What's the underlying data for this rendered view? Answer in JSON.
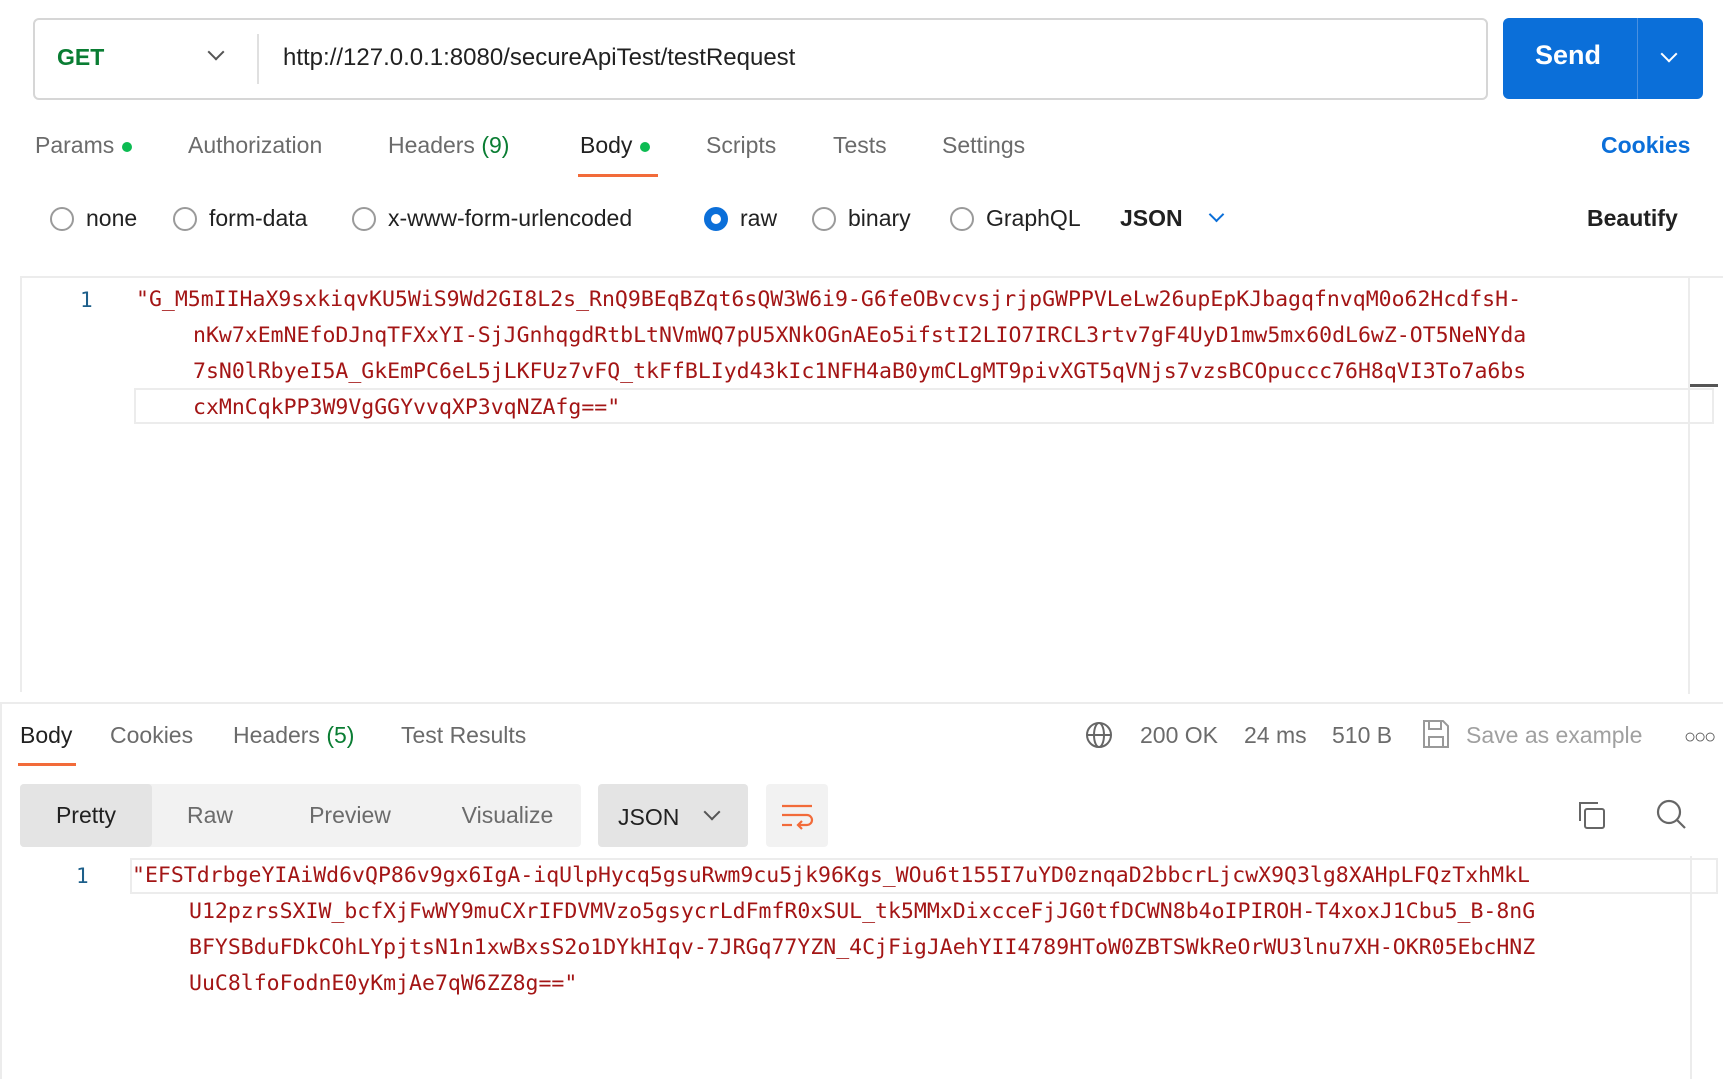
{
  "request": {
    "method": "GET",
    "url": "http://127.0.0.1:8080/secureApiTest/testRequest",
    "send_label": "Send"
  },
  "req_tabs": [
    {
      "label": "Params",
      "dot": true
    },
    {
      "label": "Authorization"
    },
    {
      "label": "Headers",
      "count": "(9)"
    },
    {
      "label": "Body",
      "dot": true,
      "active": true
    },
    {
      "label": "Scripts"
    },
    {
      "label": "Tests"
    },
    {
      "label": "Settings"
    }
  ],
  "cookies_link": "Cookies",
  "body_types": [
    "none",
    "form-data",
    "x-www-form-urlencoded",
    "raw",
    "binary",
    "GraphQL"
  ],
  "body_type_selected": "raw",
  "body_format": "JSON",
  "beautify_label": "Beautify",
  "request_body": {
    "line_number": "1",
    "lines": [
      "\"G_M5mIIHaX9sxkiqvKU5WiS9Wd2GI8L2s_RnQ9BEqBZqt6sQW3W6i9-G6feOBvcvsjrjpGWPPVLeLw26upEpKJbagqfnvqM0o62HcdfsH-",
      "nKw7xEmNEfoDJnqTFXxYI-SjJGnhqgdRtbLtNVmWQ7pU5XNkOGnAEo5ifstI2LIO7IRCL3rtv7gF4UyD1mw5mx60dL6wZ-OT5NeNYda",
      "7sN0lRbyeI5A_GkEmPC6eL5jLKFUz7vFQ_tkFfBLIyd43kIc1NFH4aB0ymCLgMT9pivXGT5qVNjs7vzsBCOpuccc76H8qVI3To7a6bs",
      "cxMnCqkPP3W9VgGGYvvqXP3vqNZAfg==\""
    ]
  },
  "resp_tabs": [
    {
      "label": "Body",
      "active": true
    },
    {
      "label": "Cookies"
    },
    {
      "label": "Headers",
      "count": "(5)"
    },
    {
      "label": "Test Results"
    }
  ],
  "status": {
    "code": "200 OK",
    "time": "24 ms",
    "size": "510 B",
    "save_label": "Save as example"
  },
  "view_modes": [
    "Pretty",
    "Raw",
    "Preview",
    "Visualize"
  ],
  "view_selected": "Pretty",
  "resp_format": "JSON",
  "response_body": {
    "line_number": "1",
    "lines": [
      "\"EFSTdrbgeYIAiWd6vQP86v9gx6IgA-iqUlpHycq5gsuRwm9cu5jk96Kgs_WOu6t155I7uYD0znqaD2bbcrLjcwX9Q3lg8XAHpLFQzTxhMkL",
      "U12pzrsSXIW_bcfXjFwWY9muCXrIFDVMVzo5gsycrLdFmfR0xSUL_tk5MMxDixcceFjJG0tfDCWN8b4oIPIROH-T4xoxJ1Cbu5_B-8nG",
      "BFYSBduFDkCOhLYpjtsN1n1xwBxsS2o1DYkHIqv-7JRGq77YZN_4CjFigJAehYII4789HToW0ZBTSWkReOrWU3lnu7XH-OKR05EbcHNZ",
      "UuC8lfoFodnE0yKmjAe7qW6ZZ8g==\""
    ]
  },
  "colors": {
    "accent": "#0b6fd9",
    "method": "#0a7d33",
    "status_ok": "#0a7d33",
    "code_string": "#a31515",
    "active_tab_underline": "#f26b3a"
  }
}
